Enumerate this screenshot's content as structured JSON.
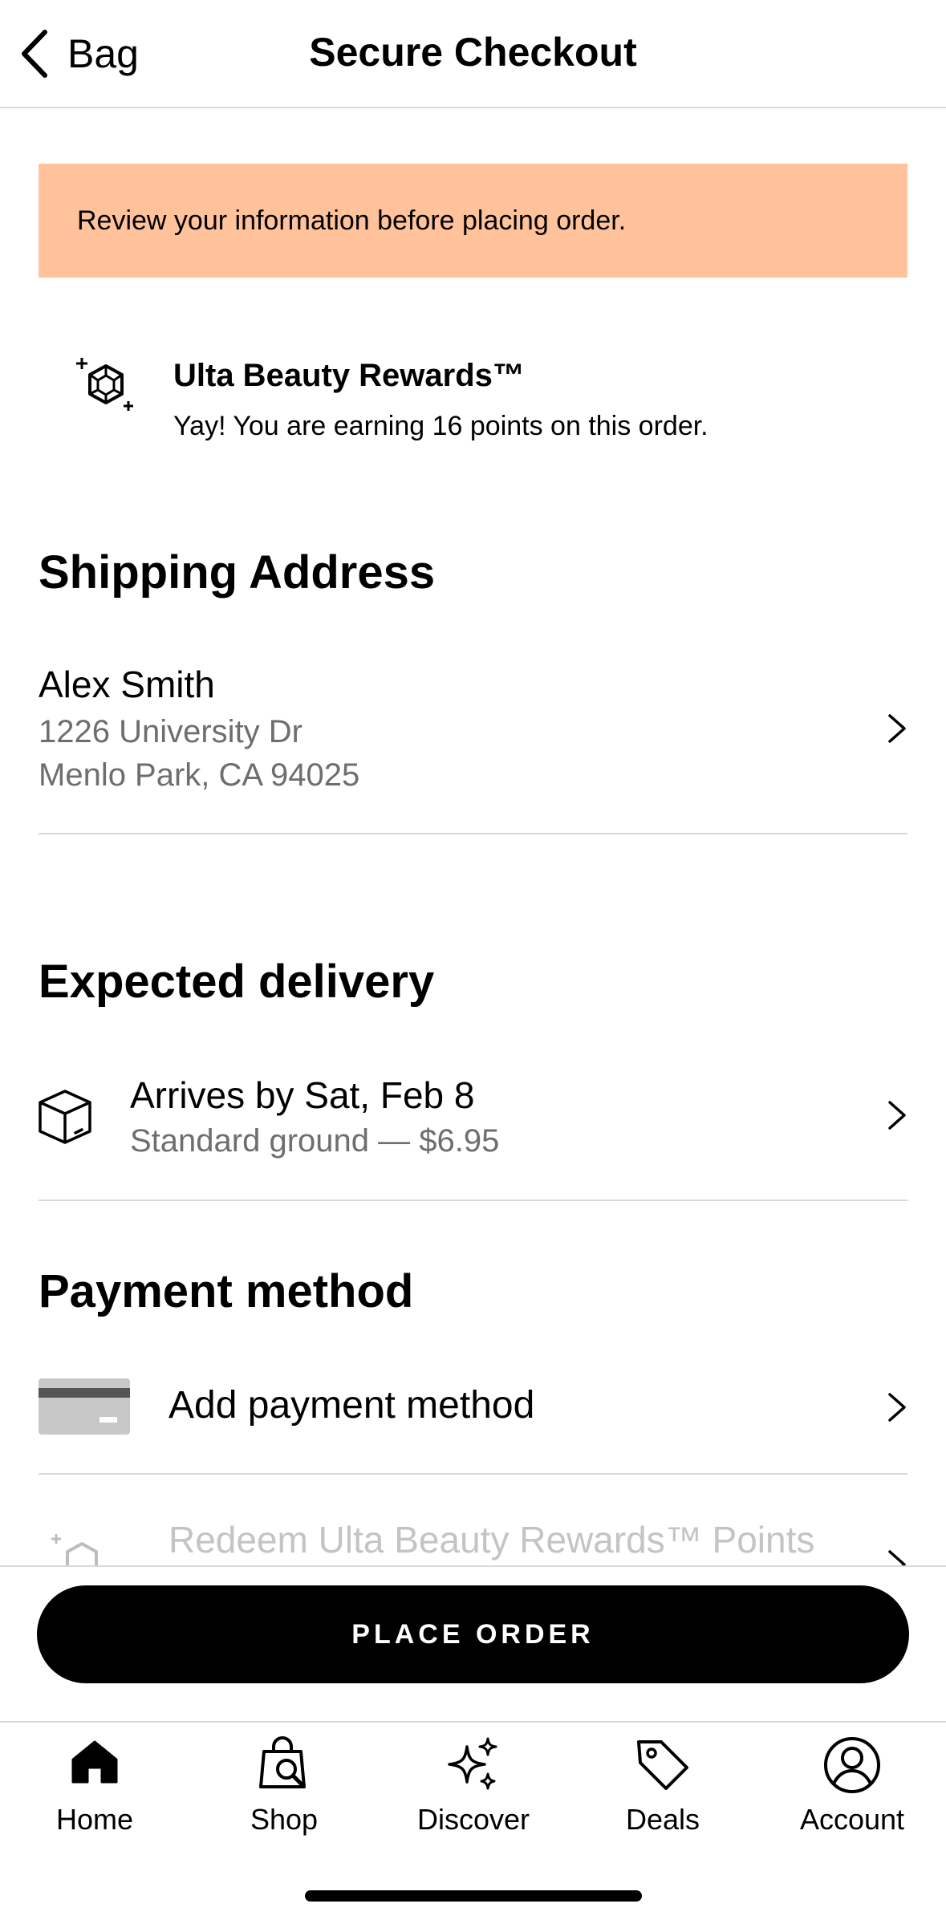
{
  "header": {
    "back_label": "Bag",
    "title": "Secure Checkout"
  },
  "banner": {
    "text": "Review your information before placing order.",
    "color": "#ffc29b"
  },
  "rewards": {
    "icon": "gem-sparkle-icon",
    "title": "Ulta Beauty Rewards™",
    "subtitle": "Yay! You are earning 16 points on this order."
  },
  "shipping": {
    "heading": "Shipping Address",
    "name": "Alex Smith",
    "line1": "1226 University Dr",
    "line2": "Menlo Park, CA 94025"
  },
  "delivery": {
    "heading": "Expected delivery",
    "icon": "package-icon",
    "arrival": "Arrives by Sat, Feb 8",
    "method": "Standard ground — $6.95"
  },
  "payment": {
    "heading": "Payment method",
    "icon": "credit-card-icon",
    "add_label": "Add payment method",
    "redeem_label": "Redeem Ulta Beauty Rewards™ Points"
  },
  "place_order": {
    "label": "PLACE ORDER"
  },
  "tabbar": {
    "items": [
      {
        "label": "Home",
        "icon": "home-icon"
      },
      {
        "label": "Shop",
        "icon": "shopping-bag-search-icon"
      },
      {
        "label": "Discover",
        "icon": "sparkles-icon"
      },
      {
        "label": "Deals",
        "icon": "tag-icon"
      },
      {
        "label": "Account",
        "icon": "user-circle-icon"
      }
    ]
  }
}
